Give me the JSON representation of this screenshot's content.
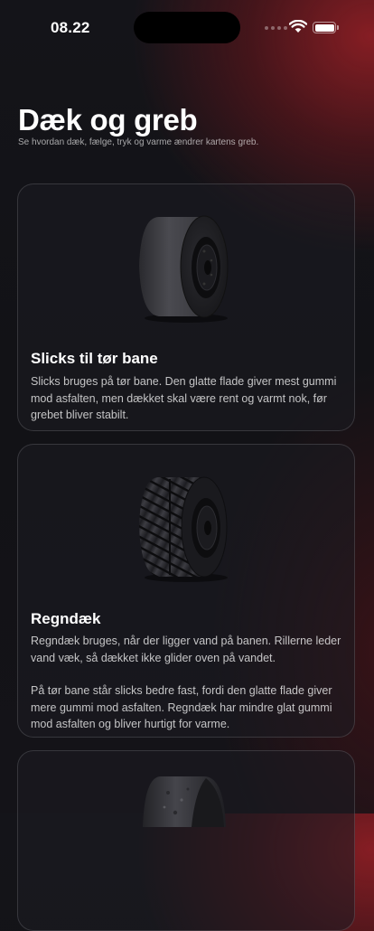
{
  "status_bar": {
    "time": "08.22"
  },
  "header": {
    "title": "Dæk og greb",
    "subtitle": "Se hvordan dæk, fælge, tryk og varme ændrer kartens greb."
  },
  "cards": [
    {
      "title": "Slicks til tør bane",
      "paragraphs": [
        "Slicks bruges på tør bane. Den glatte flade giver mest gummi mod asfalten, men dækket skal være rent og varmt nok, før grebet bliver stabilt."
      ]
    },
    {
      "title": "Regndæk",
      "paragraphs": [
        "Regndæk bruges, når der ligger vand på banen. Rillerne leder vand væk, så dækket ikke glider oven på vandet.",
        "På tør bane står slicks bedre fast, fordi den glatte flade giver mere gummi mod asfalten. Regndæk har mindre glat gummi mod asfalten og bliver hurtigt for varme."
      ]
    },
    {
      "title": "",
      "paragraphs": []
    }
  ]
}
